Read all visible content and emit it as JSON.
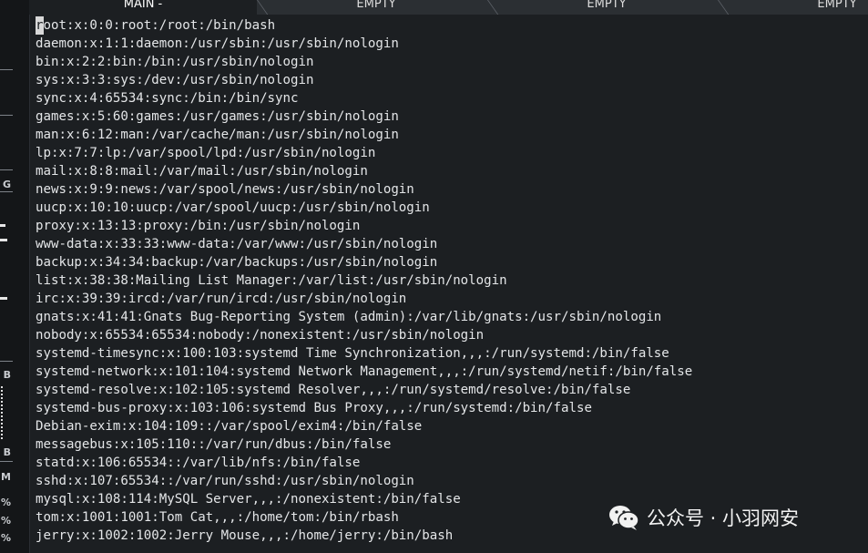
{
  "tabs": [
    {
      "label": "MAIN -",
      "active": true
    },
    {
      "label": "EMPTY",
      "active": false
    },
    {
      "label": "EMPTY",
      "active": false
    },
    {
      "label": "EMPTY",
      "active": false
    }
  ],
  "left_panel": {
    "labels": [
      "G",
      "B",
      "B",
      "M",
      "%",
      "%",
      "%"
    ]
  },
  "terminal": {
    "cursor_char": "r",
    "first_line_rest": "oot:x:0:0:root:/root:/bin/bash",
    "lines": [
      "daemon:x:1:1:daemon:/usr/sbin:/usr/sbin/nologin",
      "bin:x:2:2:bin:/bin:/usr/sbin/nologin",
      "sys:x:3:3:sys:/dev:/usr/sbin/nologin",
      "sync:x:4:65534:sync:/bin:/bin/sync",
      "games:x:5:60:games:/usr/games:/usr/sbin/nologin",
      "man:x:6:12:man:/var/cache/man:/usr/sbin/nologin",
      "lp:x:7:7:lp:/var/spool/lpd:/usr/sbin/nologin",
      "mail:x:8:8:mail:/var/mail:/usr/sbin/nologin",
      "news:x:9:9:news:/var/spool/news:/usr/sbin/nologin",
      "uucp:x:10:10:uucp:/var/spool/uucp:/usr/sbin/nologin",
      "proxy:x:13:13:proxy:/bin:/usr/sbin/nologin",
      "www-data:x:33:33:www-data:/var/www:/usr/sbin/nologin",
      "backup:x:34:34:backup:/var/backups:/usr/sbin/nologin",
      "list:x:38:38:Mailing List Manager:/var/list:/usr/sbin/nologin",
      "irc:x:39:39:ircd:/var/run/ircd:/usr/sbin/nologin",
      "gnats:x:41:41:Gnats Bug-Reporting System (admin):/var/lib/gnats:/usr/sbin/nologin",
      "nobody:x:65534:65534:nobody:/nonexistent:/usr/sbin/nologin",
      "systemd-timesync:x:100:103:systemd Time Synchronization,,,:/run/systemd:/bin/false",
      "systemd-network:x:101:104:systemd Network Management,,,:/run/systemd/netif:/bin/false",
      "systemd-resolve:x:102:105:systemd Resolver,,,:/run/systemd/resolve:/bin/false",
      "systemd-bus-proxy:x:103:106:systemd Bus Proxy,,,:/run/systemd:/bin/false",
      "Debian-exim:x:104:109::/var/spool/exim4:/bin/false",
      "messagebus:x:105:110::/var/run/dbus:/bin/false",
      "statd:x:106:65534::/var/lib/nfs:/bin/false",
      "sshd:x:107:65534::/var/run/sshd:/usr/sbin/nologin",
      "mysql:x:108:114:MySQL Server,,,:/nonexistent:/bin/false",
      "tom:x:1001:1001:Tom Cat,,,:/home/tom:/bin/rbash",
      "jerry:x:1002:1002:Jerry Mouse,,,:/home/jerry:/bin/bash"
    ]
  },
  "watermark": {
    "text": "公众号 · 小羽网安",
    "icon": "wechat-icon"
  }
}
